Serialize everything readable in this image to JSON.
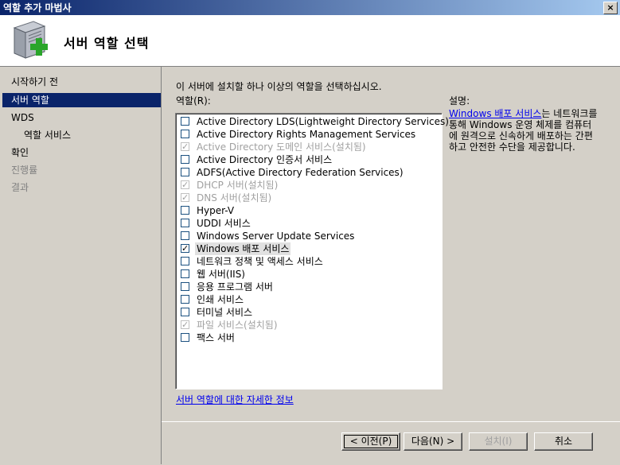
{
  "window": {
    "title": "역할 추가 마법사",
    "close": "×"
  },
  "header": {
    "title": "서버 역할 선택"
  },
  "nav": [
    {
      "label": "시작하기 전",
      "state": "normal"
    },
    {
      "label": "서버 역할",
      "state": "selected"
    },
    {
      "label": "WDS",
      "state": "normal"
    },
    {
      "label": "역할 서비스",
      "state": "sub"
    },
    {
      "label": "확인",
      "state": "normal"
    },
    {
      "label": "진행률",
      "state": "disabled"
    },
    {
      "label": "결과",
      "state": "disabled"
    }
  ],
  "main": {
    "instruction": "이 서버에 설치할 하나 이상의 역할을 선택하십시오.",
    "roles_label": "역할(R):",
    "roles": [
      {
        "label": "Active Directory LDS(Lightweight Directory Services)",
        "checked": false,
        "disabled": false
      },
      {
        "label": "Active Directory Rights Management Services",
        "checked": false,
        "disabled": false
      },
      {
        "label": "Active Directory 도메인 서비스(설치됨)",
        "checked": true,
        "disabled": true
      },
      {
        "label": "Active Directory 인증서 서비스",
        "checked": false,
        "disabled": false
      },
      {
        "label": "ADFS(Active Directory Federation Services)",
        "checked": false,
        "disabled": false
      },
      {
        "label": "DHCP 서버(설치됨)",
        "checked": true,
        "disabled": true
      },
      {
        "label": "DNS 서버(설치됨)",
        "checked": true,
        "disabled": true
      },
      {
        "label": "Hyper-V",
        "checked": false,
        "disabled": false
      },
      {
        "label": "UDDI 서비스",
        "checked": false,
        "disabled": false
      },
      {
        "label": "Windows Server Update Services",
        "checked": false,
        "disabled": false
      },
      {
        "label": "Windows 배포 서비스",
        "checked": true,
        "disabled": false,
        "selected": true
      },
      {
        "label": "네트워크 정책 및 액세스 서비스",
        "checked": false,
        "disabled": false
      },
      {
        "label": "웹 서버(IIS)",
        "checked": false,
        "disabled": false
      },
      {
        "label": "응용 프로그램 서버",
        "checked": false,
        "disabled": false
      },
      {
        "label": "인쇄 서비스",
        "checked": false,
        "disabled": false
      },
      {
        "label": "터미널 서비스",
        "checked": false,
        "disabled": false
      },
      {
        "label": "파일 서비스(설치됨)",
        "checked": true,
        "disabled": true
      },
      {
        "label": "팩스 서버",
        "checked": false,
        "disabled": false
      }
    ],
    "more_info_link": "서버 역할에 대한 자세한 정보"
  },
  "description": {
    "title": "설명:",
    "link": "Windows 배포 서비스",
    "text": "는 네트워크를 통해 Windows 운영 체제를 컴퓨터에 원격으로 신속하게 배포하는 간편하고 안전한 수단을 제공합니다."
  },
  "footer": {
    "back": "< 이전(P)",
    "next": "다음(N) >",
    "install": "설치(I)",
    "cancel": "취소"
  }
}
